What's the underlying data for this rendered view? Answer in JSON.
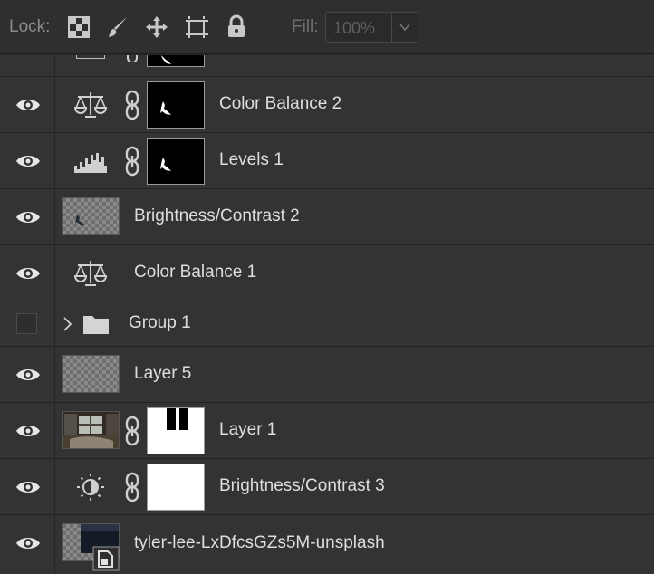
{
  "toolbar": {
    "lock_label": "Lock:",
    "fill_label": "Fill:",
    "fill_value": "100%"
  },
  "layers": [
    {
      "name": "",
      "visible": true,
      "type": "adjustment-partial"
    },
    {
      "name": "Color Balance 2",
      "visible": true,
      "type": "color-balance",
      "has_mask": true
    },
    {
      "name": "Levels 1",
      "visible": true,
      "type": "levels",
      "has_mask": true
    },
    {
      "name": "Brightness/Contrast 2",
      "visible": true,
      "type": "pixel-layer"
    },
    {
      "name": "Color Balance 1",
      "visible": true,
      "type": "color-balance"
    },
    {
      "name": "Group 1",
      "visible": false,
      "type": "group",
      "collapsed": true
    },
    {
      "name": "Layer 5",
      "visible": true,
      "type": "pixel-layer"
    },
    {
      "name": "Layer 1",
      "visible": true,
      "type": "image-with-mask",
      "has_mask": true
    },
    {
      "name": "Brightness/Contrast 3",
      "visible": true,
      "type": "brightness-contrast",
      "has_mask": true
    },
    {
      "name": "tyler-lee-LxDfcsGZs5M-unsplash",
      "visible": true,
      "type": "smart-object"
    }
  ],
  "colors": {
    "panel_bg": "#333333",
    "toolbar_bg": "#2f2f2f",
    "text": "#dedede",
    "icon": "#d0d0d0"
  }
}
